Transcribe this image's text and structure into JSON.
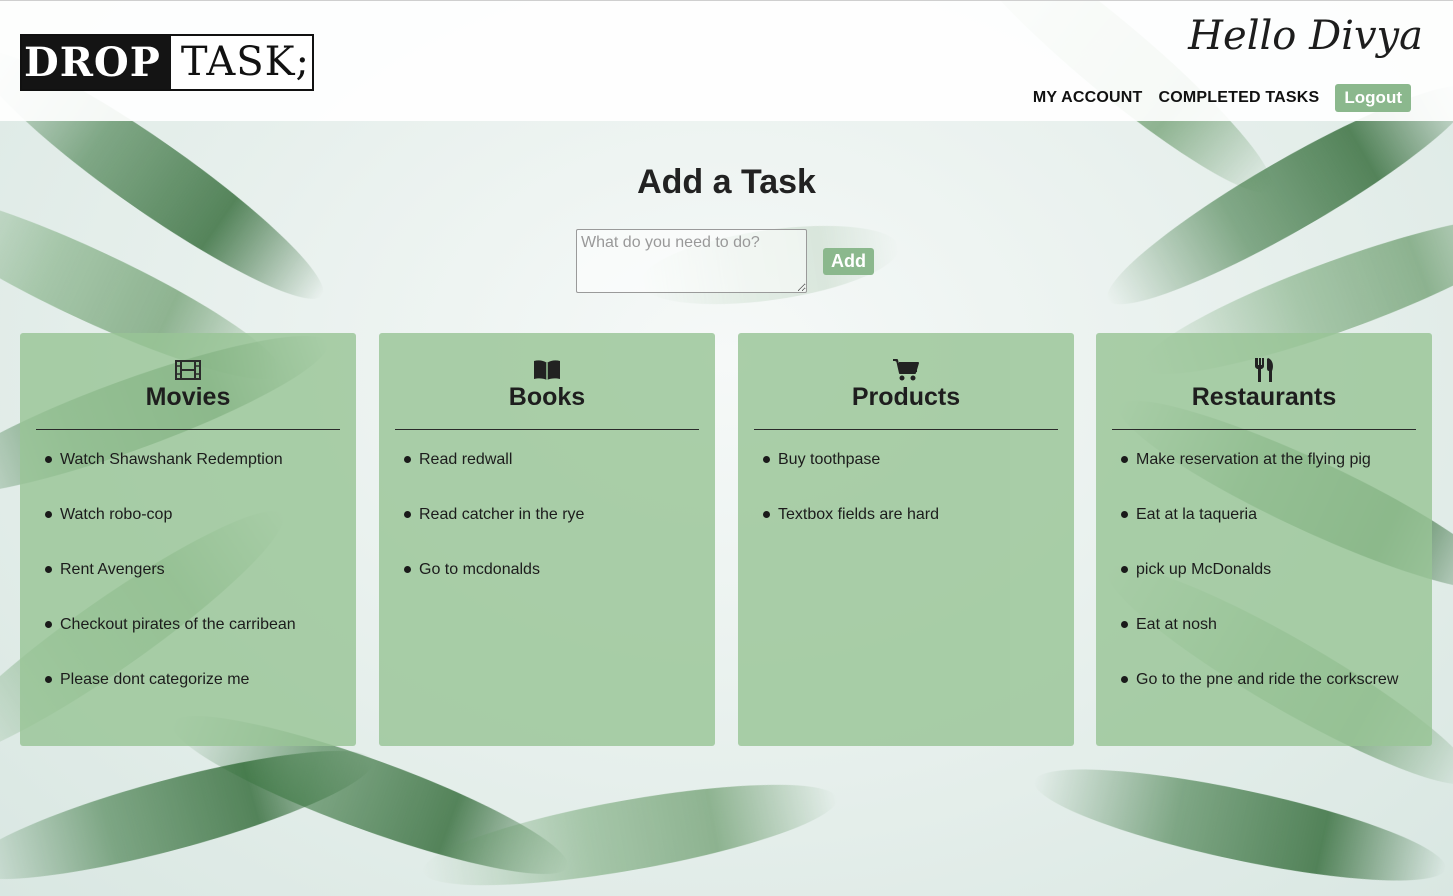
{
  "header": {
    "logo_drop": "DROP",
    "logo_task": "TASK;",
    "greeting": "Hello Divya",
    "nav": {
      "my_account": "MY ACCOUNT",
      "completed_tasks": "COMPLETED TASKS",
      "logout": "Logout"
    }
  },
  "add_task": {
    "title": "Add a Task",
    "placeholder": "What do you need to do?",
    "button": "Add"
  },
  "columns": [
    {
      "icon": "film-icon",
      "title": "Movies",
      "items": [
        "Watch Shawshank Redemption",
        "Watch robo-cop",
        "Rent Avengers",
        "Checkout pirates of the carribean",
        "Please dont categorize me"
      ]
    },
    {
      "icon": "book-icon",
      "title": "Books",
      "items": [
        "Read redwall",
        "Read catcher in the rye",
        "Go to mcdonalds"
      ]
    },
    {
      "icon": "cart-icon",
      "title": "Products",
      "items": [
        "Buy toothpase",
        "Textbox fields are hard"
      ]
    },
    {
      "icon": "utensils-icon",
      "title": "Restaurants",
      "items": [
        "Make reservation at the flying pig",
        "Eat at la taqueria",
        "pick up McDonalds",
        "Eat at nosh",
        "Go to the pne and ride the corkscrew"
      ]
    }
  ],
  "colors": {
    "accent_green": "#8bb88d",
    "column_green": "#98c496",
    "logo_dark": "#141414"
  }
}
